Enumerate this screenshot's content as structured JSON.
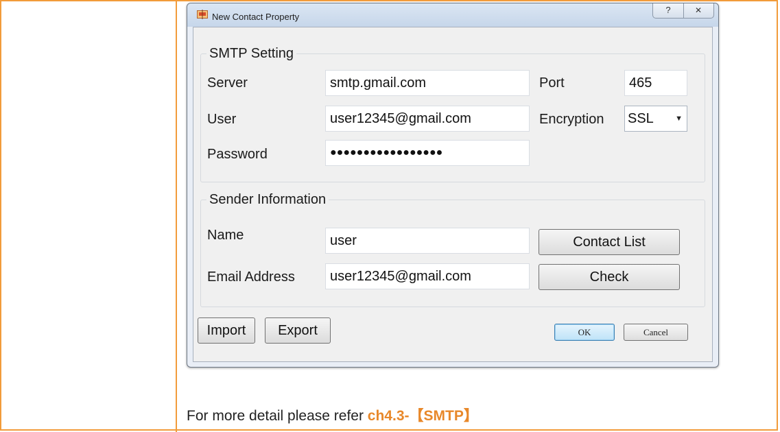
{
  "dialog": {
    "title": "New Contact Property",
    "help_glyph": "?",
    "close_glyph": "✕"
  },
  "smtp": {
    "group_label": "SMTP Setting",
    "server_label": "Server",
    "server_value": "smtp.gmail.com",
    "port_label": "Port",
    "port_value": "465",
    "user_label": "User",
    "user_value": "user12345@gmail.com",
    "encryption_label": "Encryption",
    "encryption_value": "SSL",
    "password_label": "Password",
    "password_value": "●●●●●●●●●●●●●●●●●"
  },
  "sender": {
    "group_label": "Sender Information",
    "name_label": "Name",
    "name_value": "user",
    "email_label": "Email Address",
    "email_value": "user12345@gmail.com",
    "contact_list_button": "Contact List",
    "check_button": "Check"
  },
  "buttons": {
    "import": "Import",
    "export": "Export",
    "ok": "OK",
    "cancel": "Cancel"
  },
  "note": {
    "prefix": "For more detail please refer ",
    "reference": "ch4.3-【SMTP】"
  },
  "colors": {
    "table_border": "#f29b3a",
    "reference_text": "#e8882a"
  }
}
